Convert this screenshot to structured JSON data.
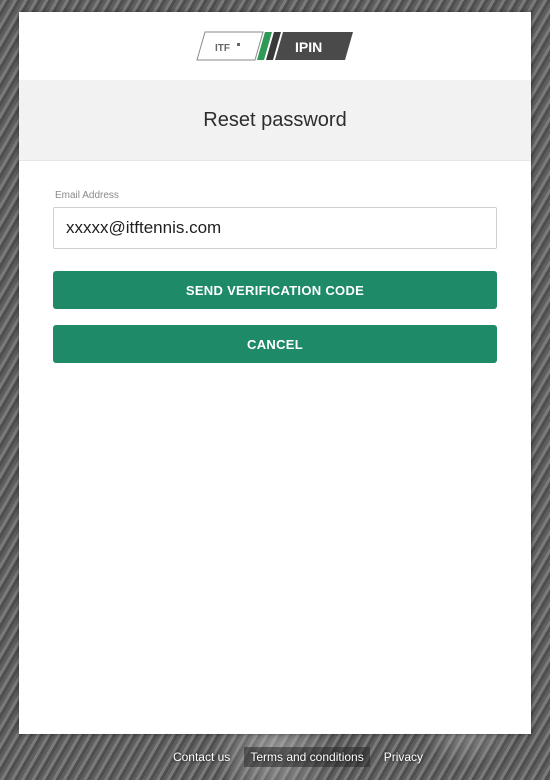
{
  "logo": {
    "left_text": "ITF",
    "right_text": "IPIN",
    "colors": {
      "box": "#4a4a4a",
      "stripe_green": "#2e9a55",
      "stripe_dark": "#3a3a3a"
    }
  },
  "page": {
    "title": "Reset password"
  },
  "form": {
    "email_label": "Email Address",
    "email_value": "xxxxx@itftennis.com"
  },
  "buttons": {
    "send_code": "SEND VERIFICATION CODE",
    "cancel": "CANCEL",
    "color": "#1e8a68"
  },
  "footer": {
    "links": [
      "Contact us",
      "Terms and conditions",
      "Privacy"
    ]
  }
}
